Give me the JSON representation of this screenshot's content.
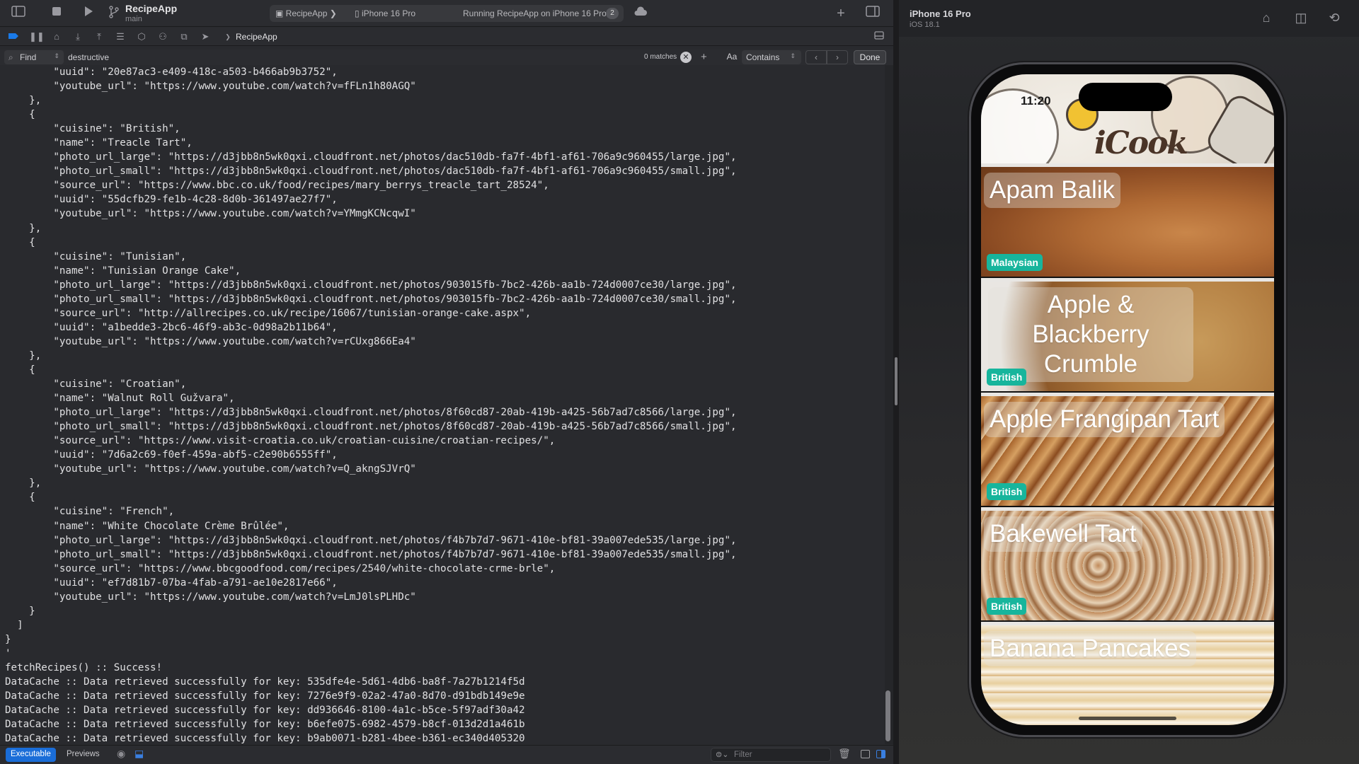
{
  "xcode": {
    "toolbar": {
      "project": "RecipeApp",
      "branch": "main",
      "activity_scheme": "RecipeApp",
      "activity_device": "iPhone 16 Pro",
      "activity_status": "Running RecipeApp on iPhone 16 Pro",
      "activity_badge": "2",
      "icons": [
        "sidebar-toggle-icon",
        "stop-icon",
        "run-icon",
        "branch-icon",
        "cloud-icon",
        "add-icon",
        "inspector-toggle-icon"
      ]
    },
    "debugbar": {
      "target": "RecipeApp",
      "icons": [
        "breakpoints-icon",
        "pause-icon",
        "step-over-icon",
        "step-into-icon",
        "step-out-icon",
        "view-hierarchy-icon",
        "memory-graph-icon",
        "environment-icon",
        "location-icon"
      ]
    },
    "find": {
      "mode": "Find",
      "query": "destructive",
      "matches": "0 matches",
      "case_label": "Aa",
      "match_type": "Contains",
      "done_label": "Done"
    },
    "console_lines": [
      "        \"uuid\": \"20e87ac3-e409-418c-a503-b466ab9b3752\",",
      "        \"youtube_url\": \"https://www.youtube.com/watch?v=fFLn1h80AGQ\"",
      "    },",
      "    {",
      "        \"cuisine\": \"British\",",
      "        \"name\": \"Treacle Tart\",",
      "        \"photo_url_large\": \"https://d3jbb8n5wk0qxi.cloudfront.net/photos/dac510db-fa7f-4bf1-af61-706a9c960455/large.jpg\",",
      "        \"photo_url_small\": \"https://d3jbb8n5wk0qxi.cloudfront.net/photos/dac510db-fa7f-4bf1-af61-706a9c960455/small.jpg\",",
      "        \"source_url\": \"https://www.bbc.co.uk/food/recipes/mary_berrys_treacle_tart_28524\",",
      "        \"uuid\": \"55dcfb29-fe1b-4c28-8d0b-361497ae27f7\",",
      "        \"youtube_url\": \"https://www.youtube.com/watch?v=YMmgKCNcqwI\"",
      "    },",
      "    {",
      "        \"cuisine\": \"Tunisian\",",
      "        \"name\": \"Tunisian Orange Cake\",",
      "        \"photo_url_large\": \"https://d3jbb8n5wk0qxi.cloudfront.net/photos/903015fb-7bc2-426b-aa1b-724d0007ce30/large.jpg\",",
      "        \"photo_url_small\": \"https://d3jbb8n5wk0qxi.cloudfront.net/photos/903015fb-7bc2-426b-aa1b-724d0007ce30/small.jpg\",",
      "        \"source_url\": \"http://allrecipes.co.uk/recipe/16067/tunisian-orange-cake.aspx\",",
      "        \"uuid\": \"a1bedde3-2bc6-46f9-ab3c-0d98a2b11b64\",",
      "        \"youtube_url\": \"https://www.youtube.com/watch?v=rCUxg866Ea4\"",
      "    },",
      "    {",
      "        \"cuisine\": \"Croatian\",",
      "        \"name\": \"Walnut Roll Gužvara\",",
      "        \"photo_url_large\": \"https://d3jbb8n5wk0qxi.cloudfront.net/photos/8f60cd87-20ab-419b-a425-56b7ad7c8566/large.jpg\",",
      "        \"photo_url_small\": \"https://d3jbb8n5wk0qxi.cloudfront.net/photos/8f60cd87-20ab-419b-a425-56b7ad7c8566/small.jpg\",",
      "        \"source_url\": \"https://www.visit-croatia.co.uk/croatian-cuisine/croatian-recipes/\",",
      "        \"uuid\": \"7d6a2c69-f0ef-459a-abf5-c2e90b6555ff\",",
      "        \"youtube_url\": \"https://www.youtube.com/watch?v=Q_akngSJVrQ\"",
      "    },",
      "    {",
      "        \"cuisine\": \"French\",",
      "        \"name\": \"White Chocolate Crème Brûlée\",",
      "        \"photo_url_large\": \"https://d3jbb8n5wk0qxi.cloudfront.net/photos/f4b7b7d7-9671-410e-bf81-39a007ede535/large.jpg\",",
      "        \"photo_url_small\": \"https://d3jbb8n5wk0qxi.cloudfront.net/photos/f4b7b7d7-9671-410e-bf81-39a007ede535/small.jpg\",",
      "        \"source_url\": \"https://www.bbcgoodfood.com/recipes/2540/white-chocolate-crme-brle\",",
      "        \"uuid\": \"ef7d81b7-07ba-4fab-a791-ae10e2817e66\",",
      "        \"youtube_url\": \"https://www.youtube.com/watch?v=LmJ0lsPLHDc\"",
      "    }",
      "  ]",
      "}",
      "'",
      "fetchRecipes() :: Success!",
      "DataCache :: Data retrieved successfully for key: 535dfe4e-5d61-4db6-ba8f-7a27b1214f5d",
      "DataCache :: Data retrieved successfully for key: 7276e9f9-02a2-47a0-8d70-d91bdb149e9e",
      "DataCache :: Data retrieved successfully for key: dd936646-8100-4a1c-b5ce-5f97adf30a42",
      "DataCache :: Data retrieved successfully for key: b6efe075-6982-4579-b8cf-013d2d1a461b",
      "DataCache :: Data retrieved successfully for key: b9ab0071-b281-4bee-b361-ec340d405320"
    ],
    "bottombar": {
      "tab_executable": "Executable",
      "tab_previews": "Previews",
      "filter_placeholder": "Filter"
    }
  },
  "simulator": {
    "device": "iPhone 16 Pro",
    "os": "iOS 18.1",
    "time": "11:20",
    "logo": "iCook",
    "accent_badge_color": "#17b59c",
    "recipes": [
      {
        "name": "Apam Balik",
        "cuisine": "Malaysian"
      },
      {
        "name": "Apple & Blackberry Crumble",
        "cuisine": "British"
      },
      {
        "name": "Apple Frangipan Tart",
        "cuisine": "British"
      },
      {
        "name": "Bakewell Tart",
        "cuisine": "British"
      },
      {
        "name": "Banana Pancakes",
        "cuisine": ""
      }
    ]
  }
}
